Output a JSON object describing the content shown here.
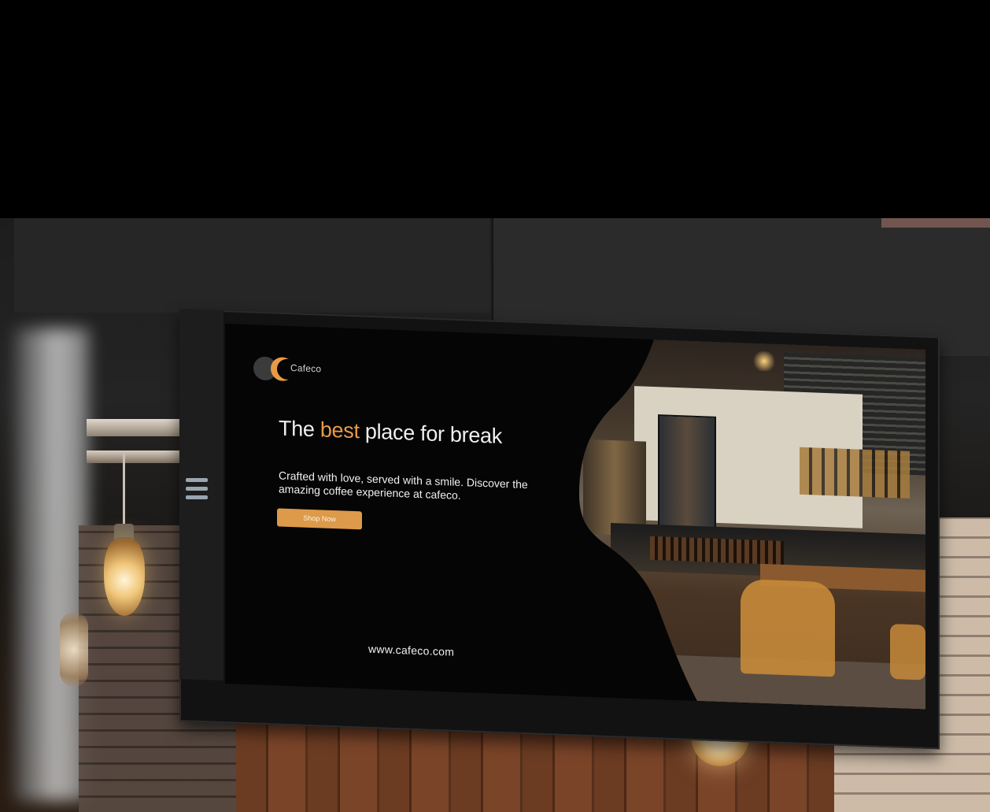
{
  "scene": {
    "description_type": "photo-of-digital-signage",
    "colors": {
      "accent": "#e89a4a",
      "button": "#dc9a4a",
      "screen_bg": "#050505"
    }
  },
  "screen": {
    "logo": {
      "icon": "crescent-moon-logo-icon",
      "text": "Cafeco"
    },
    "headline": {
      "before": "The ",
      "accent": "best",
      "after": " place for break"
    },
    "subtext": "Crafted with love, served with a smile. Discover the amazing coffee experience at cafeco.",
    "button_label": "Shop Now",
    "url": "www.cafeco.com"
  }
}
